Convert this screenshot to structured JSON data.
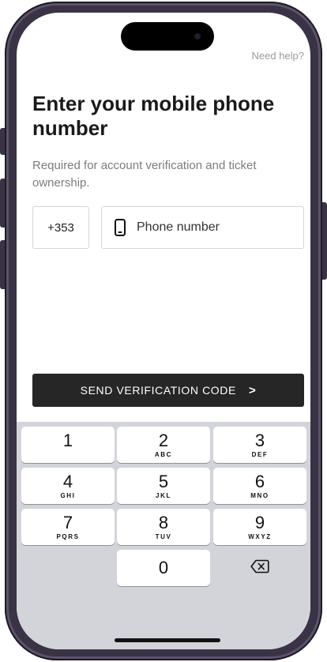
{
  "header": {
    "help_link": "Need help?"
  },
  "main": {
    "title": "Enter your mobile phone number",
    "subtitle": "Required for account verification and ticket ownership.",
    "country_code": "+353",
    "phone_placeholder": "Phone number",
    "phone_value": "",
    "send_button": "SEND VERIFICATION CODE",
    "send_arrow": ">"
  },
  "keyboard": {
    "keys": [
      {
        "num": "1",
        "letters": ""
      },
      {
        "num": "2",
        "letters": "ABC"
      },
      {
        "num": "3",
        "letters": "DEF"
      },
      {
        "num": "4",
        "letters": "GHI"
      },
      {
        "num": "5",
        "letters": "JKL"
      },
      {
        "num": "6",
        "letters": "MNO"
      },
      {
        "num": "7",
        "letters": "PQRS"
      },
      {
        "num": "8",
        "letters": "TUV"
      },
      {
        "num": "9",
        "letters": "WXYZ"
      },
      {
        "num": "0",
        "letters": ""
      }
    ],
    "delete_icon": "backspace-icon"
  },
  "colors": {
    "primary_button": "#262626",
    "keyboard_bg": "#d2d4da",
    "help_text": "#9a9a9a"
  }
}
